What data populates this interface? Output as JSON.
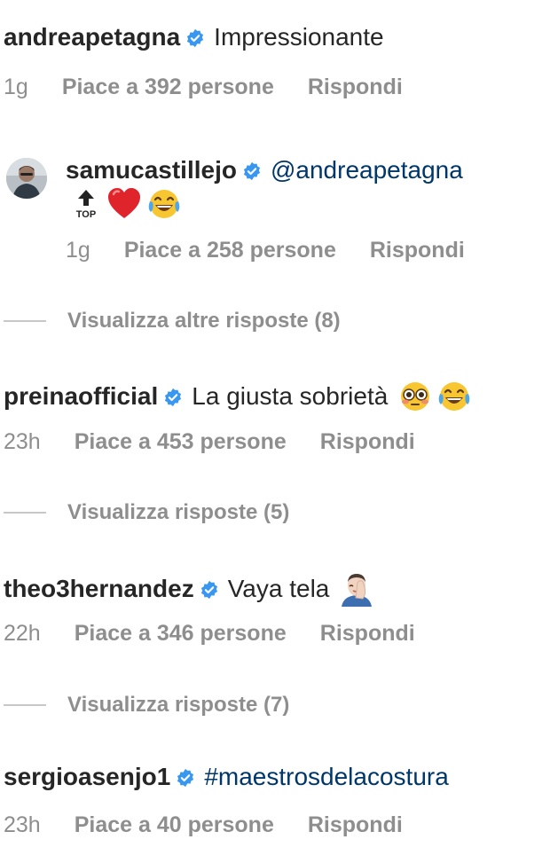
{
  "colors": {
    "text": "#262626",
    "secondary": "#8e8e8e",
    "link": "#00376b",
    "verified": "#3897f0"
  },
  "comments": [
    {
      "username": "andreapetagna",
      "text": "Impressionante",
      "time": "1g",
      "likes": "Piace a 392 persone",
      "reply": "Rispondi"
    },
    {
      "username": "samucastillejo",
      "mention": "@andreapetagna",
      "emojis": [
        "top-arrow-emoji",
        "red-heart-emoji",
        "tears-of-joy-emoji"
      ],
      "time": "1g",
      "likes": "Piace a 258 persone",
      "reply": "Rispondi"
    },
    {
      "username": "preinaofficial",
      "text": "La giusta sobrietà",
      "emojis": [
        "flushed-face-emoji",
        "tears-of-joy-emoji"
      ],
      "time": "23h",
      "likes": "Piace a 453 persone",
      "reply": "Rispondi"
    },
    {
      "username": "theo3hernandez",
      "text": "Vaya tela",
      "emojis": [
        "man-facepalming-emoji"
      ],
      "time": "22h",
      "likes": "Piace a 346 persone",
      "reply": "Rispondi"
    },
    {
      "username": "sergioasenjo1",
      "hashtag": "#maestrosdelacostura",
      "time": "23h",
      "likes": "Piace a 40 persone",
      "reply": "Rispondi"
    }
  ],
  "view_replies": [
    "Visualizza altre risposte (8)",
    "Visualizza risposte (5)",
    "Visualizza risposte (7)"
  ]
}
